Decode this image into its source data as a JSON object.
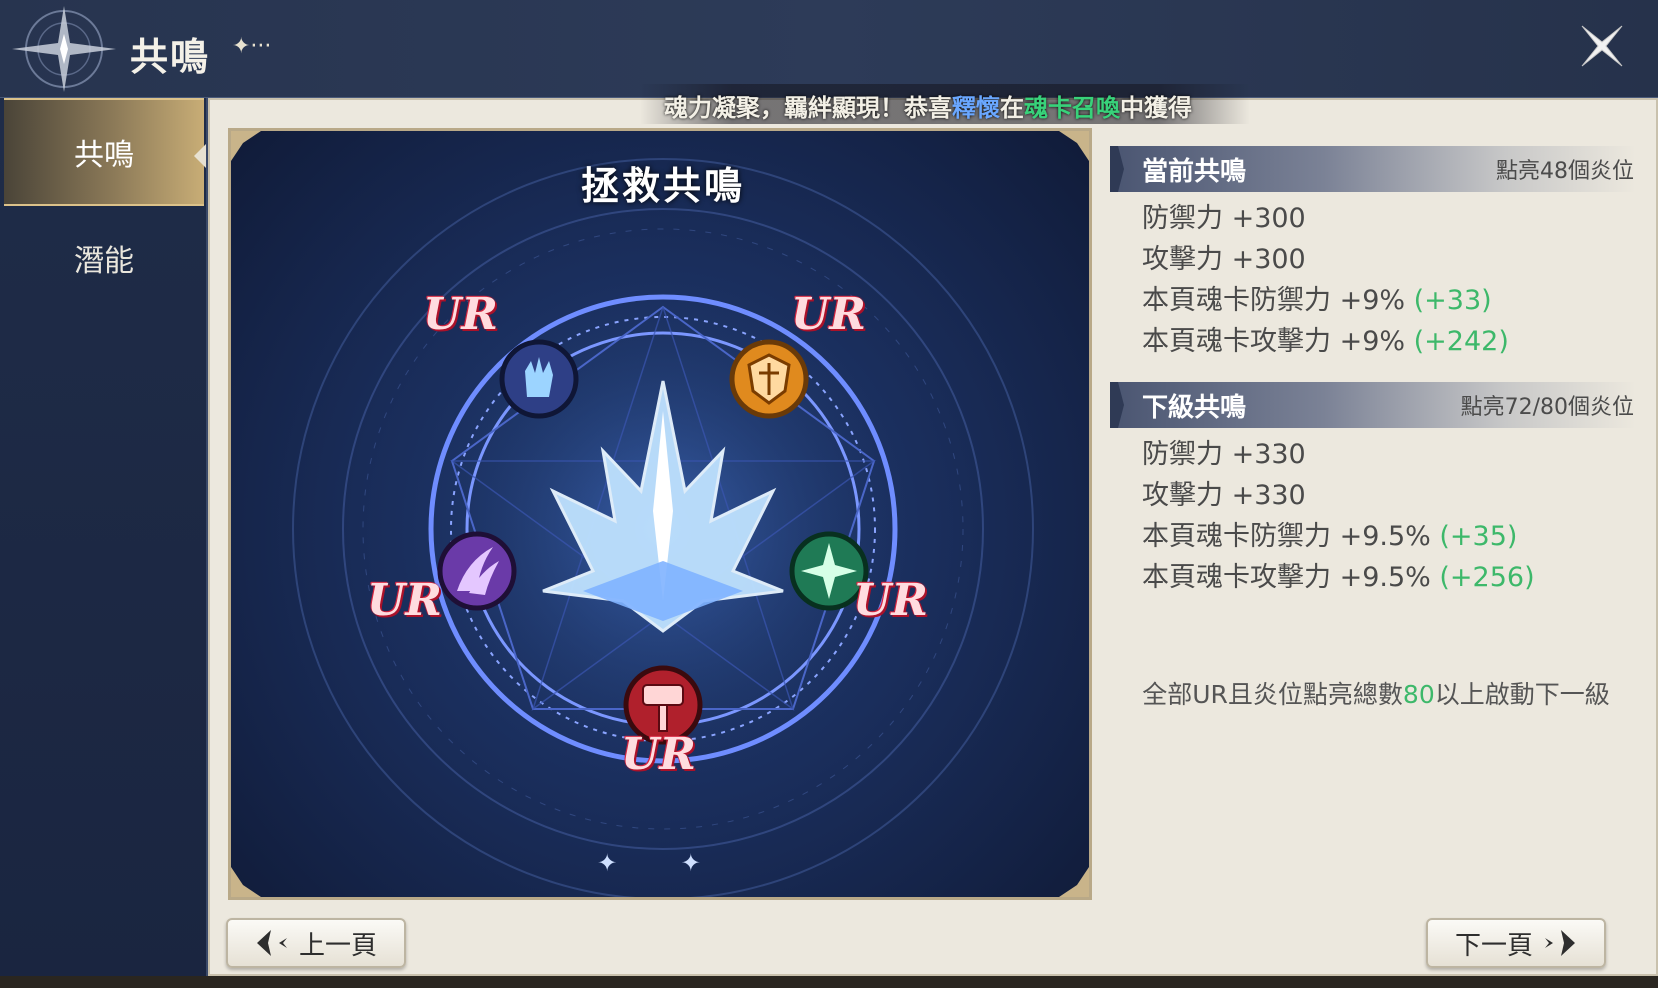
{
  "header": {
    "title": "共鳴",
    "title_deco": "✦···",
    "marquee": {
      "prefix": "魂力凝聚，羈絆顯現！恭喜",
      "name": "釋懷",
      "middle": "在",
      "feature": "魂卡召喚",
      "suffix": "中獲得"
    }
  },
  "sidebar": {
    "items": [
      {
        "label": "共鳴",
        "active": true
      },
      {
        "label": "潛能",
        "active": false
      }
    ]
  },
  "circle": {
    "title": "拯救共鳴",
    "nodes": [
      {
        "rarity": "UR",
        "icon": "ice-hand-icon",
        "color": "#2e3f86"
      },
      {
        "rarity": "UR",
        "icon": "shield-crest-icon",
        "color": "#e08a1e"
      },
      {
        "rarity": "UR",
        "icon": "purple-claw-icon",
        "color": "#6a3aa8"
      },
      {
        "rarity": "UR",
        "icon": "green-star-icon",
        "color": "#1f7a55"
      },
      {
        "rarity": "UR",
        "icon": "war-hammer-icon",
        "color": "#b0202c"
      }
    ],
    "page_dots": "✦ ✦"
  },
  "current": {
    "title": "當前共鳴",
    "value": "點亮48個炎位",
    "stats": [
      {
        "text": "防禦力 +300",
        "bonus": ""
      },
      {
        "text": "攻擊力 +300",
        "bonus": ""
      },
      {
        "text": "本頁魂卡防禦力 +9% ",
        "bonus": "(+33)"
      },
      {
        "text": "本頁魂卡攻擊力 +9% ",
        "bonus": "(+242)"
      }
    ]
  },
  "next_level": {
    "title": "下級共鳴",
    "value": "點亮72/80個炎位",
    "stats": [
      {
        "text": "防禦力 +330",
        "bonus": ""
      },
      {
        "text": "攻擊力 +330",
        "bonus": ""
      },
      {
        "text": "本頁魂卡防禦力 +9.5% ",
        "bonus": "(+35)"
      },
      {
        "text": "本頁魂卡攻擊力 +9.5% ",
        "bonus": "(+256)"
      }
    ]
  },
  "note": {
    "prefix": "全部UR且炎位點亮總數",
    "highlight": "80",
    "suffix": "以上啟動下一級"
  },
  "buttons": {
    "prev": "上一頁",
    "next": "下一頁"
  },
  "colors": {
    "bonus_green": "#3db86a",
    "name_blue": "#6aa7ff",
    "ur_red": "#c0152c"
  }
}
